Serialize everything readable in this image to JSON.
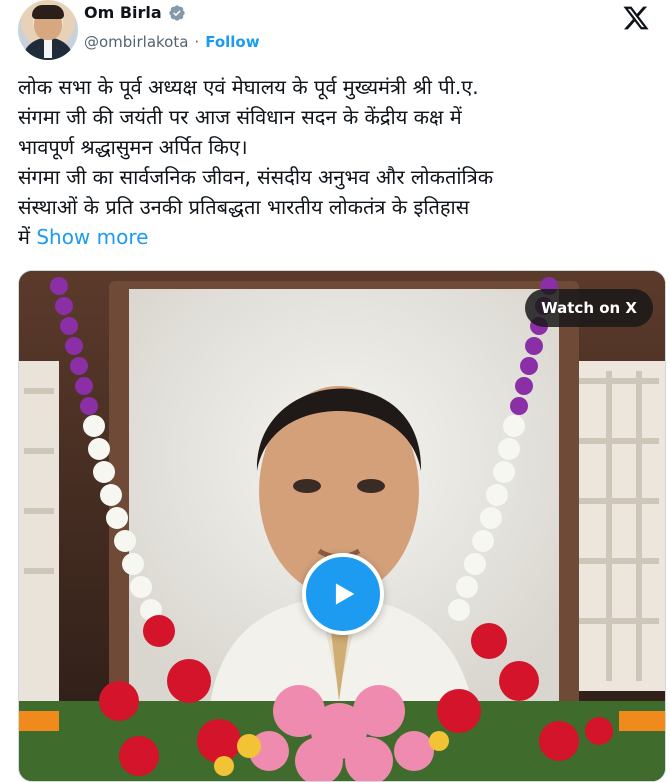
{
  "author": {
    "name": "Om Birla",
    "handle": "@ombirlakota",
    "separator": "·",
    "follow_label": "Follow",
    "avatar_icon": "avatar-photo",
    "verified_icon": "verified-badge-icon",
    "platform_icon": "x-logo-icon"
  },
  "post": {
    "text": "लोक सभा के पूर्व अध्यक्ष एवं मेघालय के पूर्व मुख्यमंत्री श्री पी.ए.\nसंगमा जी की जयंती पर आज संविधान सदन के केंद्रीय कक्ष में\nभावपूर्ण श्रद्धासुमन अर्पित किए।\nसंगमा जी का सार्वजनिक जीवन, संसदीय अनुभव और लोकतांत्रिक\nसंस्थाओं के प्रति उनकी प्रतिबद्धता भारतीय लोकतंत्र के इतिहास\nमें ",
    "show_more": "Show more"
  },
  "media": {
    "watch_label": "Watch on X",
    "play_icon": "play-icon"
  },
  "colors": {
    "accent": "#1d9bf0",
    "text": "#0f1419",
    "muted": "#536471"
  }
}
